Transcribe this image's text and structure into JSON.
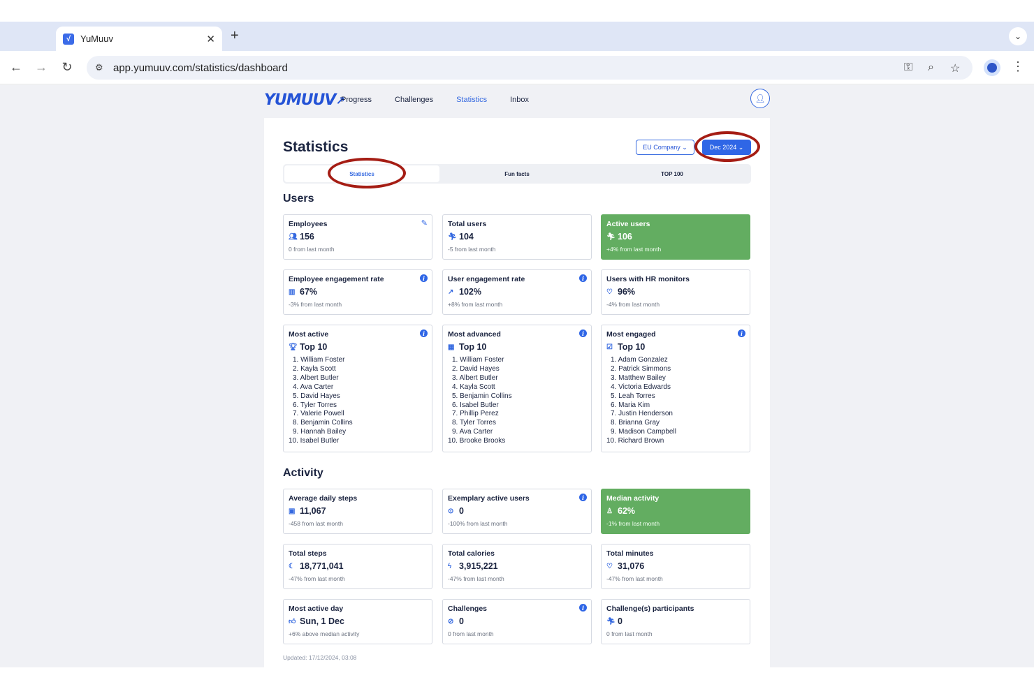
{
  "browser": {
    "tab_title": "YuMuuv",
    "favicon_glyph": "√",
    "url": "app.yumuuv.com/statistics/dashboard"
  },
  "nav": {
    "logo": "YUMUUV",
    "links": [
      "Progress",
      "Challenges",
      "Statistics",
      "Inbox"
    ],
    "active": "Statistics"
  },
  "header": {
    "title": "Statistics",
    "company": "EU Company",
    "month": "Dec 2024"
  },
  "tabs": [
    "Statistics",
    "Fun facts",
    "TOP 100"
  ],
  "users": {
    "section_title": "Users",
    "employees": {
      "title": "Employees",
      "value": "156",
      "sub": "0 from last month",
      "icon": "people-icon"
    },
    "total_users": {
      "title": "Total users",
      "value": "104",
      "sub": "-5 from last month",
      "icon": "runner-icon"
    },
    "active_users": {
      "title": "Active users",
      "value": "106",
      "sub": "+4% from last month",
      "icon": "runner-icon"
    },
    "employee_engagement": {
      "title": "Employee engagement rate",
      "value": "67%",
      "sub": "-3% from last month",
      "icon": "bar-chart-icon"
    },
    "user_engagement": {
      "title": "User engagement rate",
      "value": "102%",
      "sub": "+8% from last month",
      "icon": "trend-up-icon"
    },
    "hr_monitors": {
      "title": "Users with HR monitors",
      "value": "96%",
      "sub": "-4% from last month",
      "icon": "heart-icon"
    },
    "most_active": {
      "title": "Most active",
      "value": "Top 10",
      "icon": "trophy-icon",
      "list": [
        "1. William Foster",
        "2. Kayla Scott",
        "3. Albert Butler",
        "4. Ava Carter",
        "5. David Hayes",
        "6. Tyler Torres",
        "7. Valerie Powell",
        "8. Benjamin Collins",
        "9. Hannah Bailey",
        "10. Isabel Butler"
      ]
    },
    "most_advanced": {
      "title": "Most advanced",
      "value": "Top 10",
      "icon": "chart-up-icon",
      "list": [
        "1. William Foster",
        "2. David Hayes",
        "3. Albert Butler",
        "4. Kayla Scott",
        "5. Benjamin Collins",
        "6. Isabel Butler",
        "7. Phillip Perez",
        "8. Tyler Torres",
        "9. Ava Carter",
        "10. Brooke Brooks"
      ]
    },
    "most_engaged": {
      "title": "Most engaged",
      "value": "Top 10",
      "icon": "check-circle-icon",
      "list": [
        "1. Adam Gonzalez",
        "2. Patrick Simmons",
        "3. Matthew Bailey",
        "4. Victoria Edwards",
        "5. Leah Torres",
        "6. Maria Kim",
        "7. Justin Henderson",
        "8. Brianna Gray",
        "9. Madison Campbell",
        "10. Richard Brown"
      ]
    }
  },
  "activity": {
    "section_title": "Activity",
    "avg_daily_steps": {
      "title": "Average daily steps",
      "value": "11,067",
      "sub": "-458 from last month",
      "icon": "calendar-icon"
    },
    "exemplary_users": {
      "title": "Exemplary active users",
      "value": "0",
      "sub": "-100% from last month",
      "icon": "check-circle-icon"
    },
    "median_activity": {
      "title": "Median activity",
      "value": "62%",
      "sub": "-1% from last month",
      "icon": "activity-icon"
    },
    "total_steps": {
      "title": "Total steps",
      "value": "18,771,041",
      "sub": "-47% from last month",
      "icon": "footprint-icon"
    },
    "total_calories": {
      "title": "Total calories",
      "value": "3,915,221",
      "sub": "-47% from last month",
      "icon": "bolt-icon"
    },
    "total_minutes": {
      "title": "Total minutes",
      "value": "31,076",
      "sub": "-47% from last month",
      "icon": "heartbeat-icon"
    },
    "most_active_day": {
      "title": "Most active day",
      "value": "Sun, 1 Dec",
      "sub": "+6% above median activity",
      "icon": "thumbs-up-icon"
    },
    "challenges": {
      "title": "Challenges",
      "value": "0",
      "sub": "0 from last month",
      "icon": "check-circle-icon"
    },
    "challenge_participants": {
      "title": "Challenge(s) participants",
      "value": "0",
      "sub": "0 from last month",
      "icon": "runner-icon"
    }
  },
  "updated": "Updated: 17/12/2024, 03:08",
  "colors": {
    "accent": "#2f66e6",
    "highlight_card": "#63ad61",
    "annotation": "#a51d14"
  }
}
